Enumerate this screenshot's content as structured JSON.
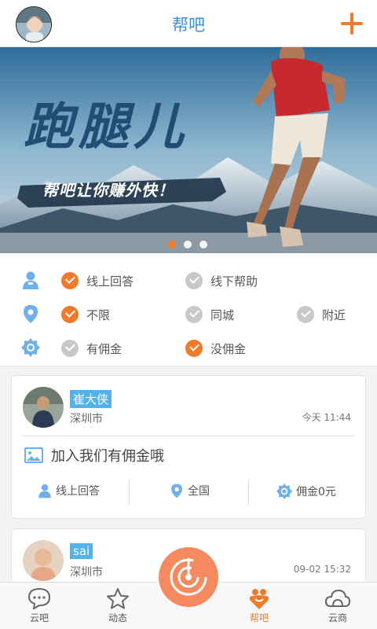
{
  "header": {
    "title": "帮吧",
    "avatar_icon": "user-avatar",
    "add_icon": "plus-icon",
    "accent": "#3b8fd9",
    "plus_color": "#f27a2b"
  },
  "banner": {
    "title": "跑腿儿",
    "slogan": "帮吧让你赚外快！",
    "page_count": 3,
    "active_page": 1
  },
  "filters": {
    "rows": [
      {
        "icon": "person-icon",
        "options": [
          {
            "label": "线上回答",
            "checked": true
          },
          {
            "label": "线下帮助",
            "checked": false
          }
        ]
      },
      {
        "icon": "location-pin-icon",
        "options": [
          {
            "label": "不限",
            "checked": true
          },
          {
            "label": "同城",
            "checked": false
          },
          {
            "label": "附近",
            "checked": false
          }
        ]
      },
      {
        "icon": "badge-icon",
        "options": [
          {
            "label": "有佣金",
            "checked": false
          },
          {
            "label": "没佣金",
            "checked": true
          }
        ]
      }
    ]
  },
  "posts": [
    {
      "name": "崔大侠",
      "city": "深圳市",
      "time": "今天 11:44",
      "content": "加入我们有佣金哦",
      "tags": [
        {
          "icon": "person-icon",
          "label": "线上回答"
        },
        {
          "icon": "location-pin-icon",
          "label": "全国"
        },
        {
          "icon": "badge-icon",
          "label": "佣金0元"
        }
      ]
    },
    {
      "name": "sai",
      "city": "深圳市",
      "time": "09-02 15:32"
    }
  ],
  "tabbar": {
    "tabs": [
      {
        "label": "云吧",
        "icon": "chat-bubble-icon"
      },
      {
        "label": "动态",
        "icon": "star-icon"
      },
      {
        "label": "帮吧",
        "icon": "help-hands-icon",
        "active": true
      },
      {
        "label": "云商",
        "icon": "cloud-icon"
      }
    ],
    "center_icon": "radar-icon",
    "active_color": "#f27a2b"
  }
}
